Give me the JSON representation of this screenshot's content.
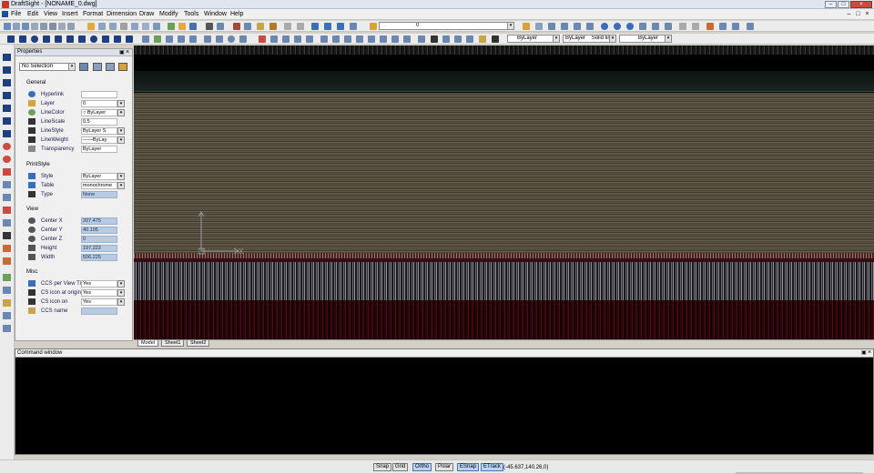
{
  "window": {
    "title": "DraftSight - [NONAME_0.dwg]",
    "min": "–",
    "max": "□",
    "close": "×"
  },
  "menu": {
    "items": [
      {
        "label": "File",
        "name": "menu-file"
      },
      {
        "label": "Edit",
        "name": "menu-edit"
      },
      {
        "label": "View",
        "name": "menu-view"
      },
      {
        "label": "Insert",
        "name": "menu-insert"
      },
      {
        "label": "Format",
        "name": "menu-format"
      },
      {
        "label": "Dimension",
        "name": "menu-dimension"
      },
      {
        "label": "Draw",
        "name": "menu-draw"
      },
      {
        "label": "Modify",
        "name": "menu-modify"
      },
      {
        "label": "Tools",
        "name": "menu-tools"
      },
      {
        "label": "Window",
        "name": "menu-window"
      },
      {
        "label": "Help",
        "name": "menu-help"
      }
    ]
  },
  "toolbar": {
    "layer_combo": "0",
    "color_combo": "ByLayer",
    "linestyle_combo": "ByLayer",
    "linestyle_type": "Solid line",
    "lineweight_combo": "ByLayer",
    "dropdown_arrow": "▾"
  },
  "properties": {
    "title": "Properties",
    "selection": "No Selection",
    "close": "×",
    "pin": "▣",
    "sections": {
      "general": "General",
      "printstyle": "PrintStyle",
      "view": "View",
      "misc": "Misc"
    },
    "general": [
      {
        "label": "Hyperlink",
        "value": ""
      },
      {
        "label": "Layer",
        "value": "0"
      },
      {
        "label": "LineColor",
        "value": "○ ByLayer"
      },
      {
        "label": "LineScale",
        "value": "0.5"
      },
      {
        "label": "LineStyle",
        "value": "ByLayer  S"
      },
      {
        "label": "LineWeight",
        "value": "——ByLay"
      },
      {
        "label": "Transparency",
        "value": "ByLayer"
      }
    ],
    "printstyle": [
      {
        "label": "Style",
        "value": "ByLayer"
      },
      {
        "label": "Table",
        "value": "monochrome"
      },
      {
        "label": "Type",
        "value": "None"
      }
    ],
    "view": [
      {
        "label": "Center X",
        "value": "207.475"
      },
      {
        "label": "Center Y",
        "value": "40.105"
      },
      {
        "label": "Center Z",
        "value": "0"
      },
      {
        "label": "Height",
        "value": "197.222"
      },
      {
        "label": "Width",
        "value": "506.225"
      }
    ],
    "misc": [
      {
        "label": "CCS per View Tile",
        "value": "Yes"
      },
      {
        "label": "CS icon at origin",
        "value": "Yes"
      },
      {
        "label": "CS icon on",
        "value": "Yes"
      },
      {
        "label": "CCS name",
        "value": ""
      }
    ]
  },
  "canvas": {
    "axis_x": "X",
    "axis_y": "Y"
  },
  "tabs": [
    {
      "label": "Model",
      "active": true
    },
    {
      "label": "Sheet1",
      "active": false
    },
    {
      "label": "Sheet2",
      "active": false
    }
  ],
  "command_window": {
    "title": "Command window"
  },
  "status": {
    "buttons": [
      {
        "label": "Snap",
        "on": false
      },
      {
        "label": "Grid",
        "on": false
      },
      {
        "label": "Ortho",
        "on": true
      },
      {
        "label": "Polar",
        "on": false
      },
      {
        "label": "ESnap",
        "on": true
      },
      {
        "label": "ETrack",
        "on": true
      }
    ],
    "coords": "(-45.637,140.26,0)"
  },
  "colors": {
    "accent": "#4a74b4",
    "canvas_bg": "#000000",
    "readonly_field": "#b9cbe3"
  }
}
